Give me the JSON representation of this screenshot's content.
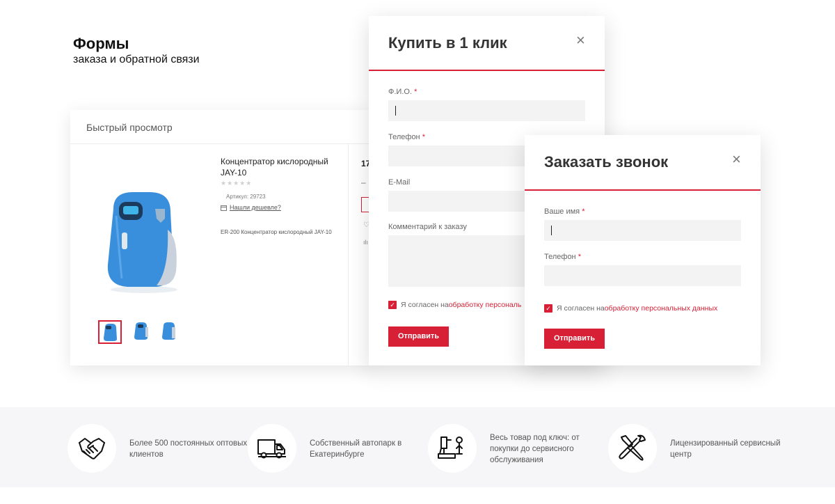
{
  "hero": {
    "title": "Формы",
    "subtitle": "заказа и обратной связи"
  },
  "quickview": {
    "title": "Быстрый просмотр",
    "product": {
      "name": "Концентратор кислородный JAY-10",
      "rating_stars": "★★★★★",
      "sku": "Артикул: 29723",
      "cheaper_link": "Нашли дешевле?",
      "description": "ER-200 Концентратор кислородный JAY-10"
    },
    "right_column": {
      "price_fragment": "17",
      "minus": "–",
      "heart": "♡",
      "bars": "ılı"
    },
    "product_color": "#3a8fdc"
  },
  "buy_one_click": {
    "title": "Купить в 1 клик",
    "close": "×",
    "fields": [
      {
        "label": "Ф.И.О.",
        "required": "*"
      },
      {
        "label": "Телефон",
        "required": "*"
      },
      {
        "label": "E-Mail",
        "required": ""
      },
      {
        "label": "Комментарий к заказу",
        "required": ""
      }
    ],
    "agree_text": "Я согласен на ",
    "agree_link": "обработку персональ",
    "submit": "Отправить"
  },
  "callback": {
    "title": "Заказать звонок",
    "close": "×",
    "fields": [
      {
        "label": "Ваше имя",
        "required": "*"
      },
      {
        "label": "Телефон",
        "required": "*"
      }
    ],
    "agree_text": "Я согласен на ",
    "agree_link": "обработку персональных данных",
    "submit": "Отправить"
  },
  "features": [
    {
      "icon": "handshake-icon",
      "text": "Более 500 постоянных оптовых клиентов"
    },
    {
      "icon": "truck-icon",
      "text": "Собственный автопарк в Екатеринбурге"
    },
    {
      "icon": "microscope-icon",
      "text": "Весь товар под ключ: от покупки до сервисного обслуживания"
    },
    {
      "icon": "tools-icon",
      "text": "Лицензированный сервисный центр"
    }
  ],
  "colors": {
    "accent": "#d71f35",
    "features_bg": "#f6f6f8",
    "input_bg": "#f3f3f3"
  }
}
